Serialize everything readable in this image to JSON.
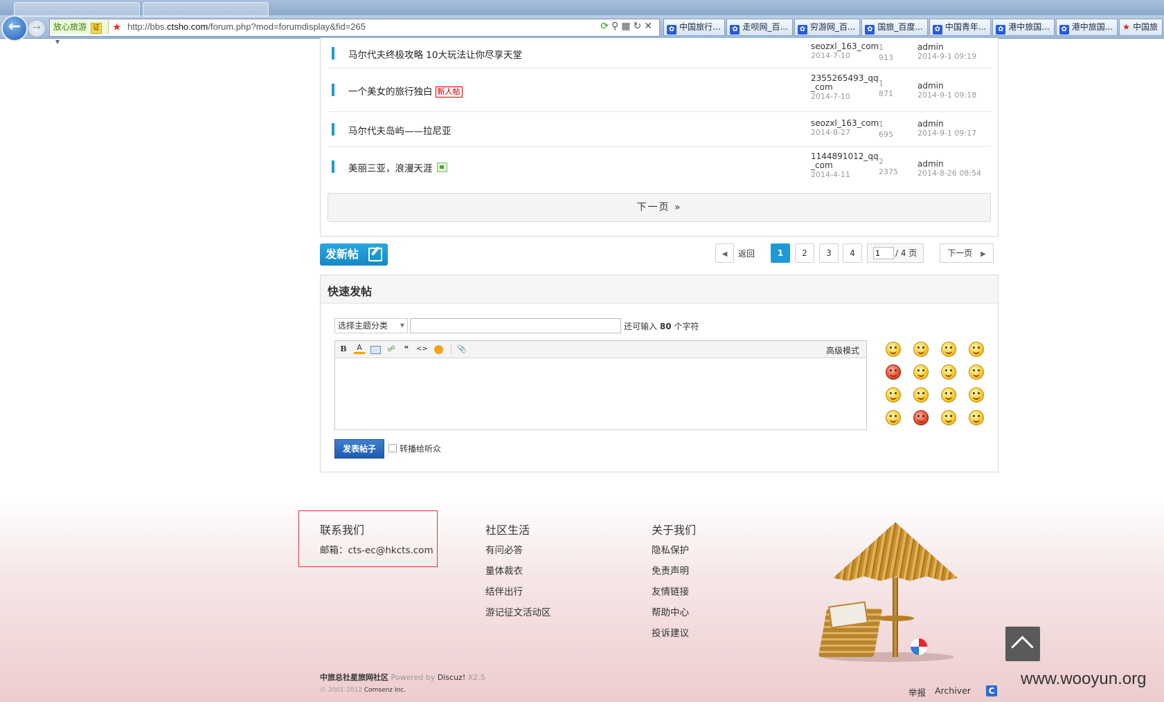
{
  "browser": {
    "address": {
      "safety_label": "放心旅游",
      "safety_cert": "证",
      "url_prefix": "http://bbs.",
      "url_domain": "ctsho.com",
      "url_suffix": "/forum.php?mod=forumdisplay&fid=265"
    },
    "favorites": [
      {
        "label": "中国旅行...",
        "icon": "baidu-paw-icon"
      },
      {
        "label": "走呗网_百...",
        "icon": "baidu-paw-icon"
      },
      {
        "label": "穷游网_百...",
        "icon": "baidu-paw-icon"
      },
      {
        "label": "国旅_百度...",
        "icon": "baidu-paw-icon"
      },
      {
        "label": "中国青年...",
        "icon": "baidu-paw-icon"
      },
      {
        "label": "港中旅国...",
        "icon": "baidu-paw-icon"
      },
      {
        "label": "港中旅国...",
        "icon": "baidu-paw-icon"
      },
      {
        "label": "中国旅",
        "icon": "star-icon"
      }
    ]
  },
  "threads": [
    {
      "title": "马尔代夫终极攻略 10大玩法让你尽享天堂",
      "badge": "",
      "author": "seozxl_163_com",
      "date": "2014-7-10",
      "replies": "1",
      "views": "913",
      "last_user": "admin",
      "last_time": "2014-9-1 09:19"
    },
    {
      "title": "一个美女的旅行独白",
      "badge": "新人帖",
      "author": "2355265493_qq_com",
      "date": "2014-7-10",
      "replies": "1",
      "views": "871",
      "last_user": "admin",
      "last_time": "2014-9-1 09:18"
    },
    {
      "title": "马尔代夫岛屿——拉尼亚",
      "badge": "",
      "author": "seozxl_163_com",
      "date": "2014-8-27",
      "replies": "1",
      "views": "695",
      "last_user": "admin",
      "last_time": "2014-9-1 09:17"
    },
    {
      "title": "美丽三亚，浪漫天涯",
      "badge": "image",
      "author": "1144891012_qq_com",
      "date": "2014-4-11",
      "replies": "2",
      "views": "2375",
      "last_user": "admin",
      "last_time": "2014-8-26 08:54"
    }
  ],
  "list": {
    "next_page": "下一页 »"
  },
  "actions": {
    "new_post": "发新帖",
    "back": "返回",
    "pages": [
      "1",
      "2",
      "3",
      "4"
    ],
    "current_page": "1",
    "page_input_value": "1",
    "page_total": "/ 4 页",
    "next": "下一页"
  },
  "quick_post": {
    "title": "快速发帖",
    "type_select": "选择主题分类",
    "remain_prefix": "还可输入",
    "remain_count": "80",
    "remain_suffix": "个字符",
    "toolbar": {
      "bold": "B",
      "color": "A",
      "quote": "“",
      "code": "<>",
      "advanced": "高级模式"
    },
    "submit": "发表帖子",
    "broadcast": "转播给听众",
    "smileys": 16
  },
  "footer": {
    "contact": {
      "heading": "联系我们",
      "email": "邮箱：cts-ec@hkcts.com"
    },
    "community": {
      "heading": "社区生活",
      "links": [
        "有问必答",
        "量体裁衣",
        "结伴出行",
        "游记征文活动区"
      ]
    },
    "about": {
      "heading": "关于我们",
      "links": [
        "隐私保护",
        "免责声明",
        "友情链接",
        "帮助中心",
        "投诉建议"
      ]
    },
    "site_name": "中旅总社星旅网社区",
    "powered_by": "Powered by",
    "discuz": "Discuz!",
    "version": "X2.5",
    "copyright_years": "© 2001-2012",
    "copyright_owner": "Comsenz Inc.",
    "report": "举报",
    "archiver": "Archiver",
    "watermark": "www.wooyun.org"
  }
}
